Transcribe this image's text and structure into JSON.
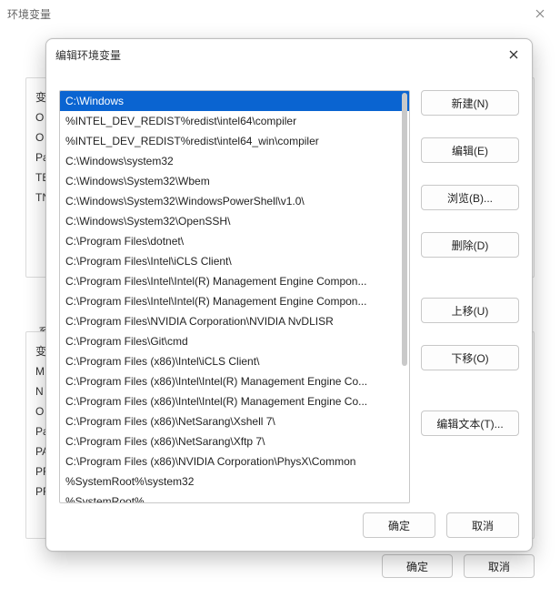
{
  "outer": {
    "title": "环境变量",
    "user_group_label": "",
    "sys_group_label": "系统",
    "user_col": [
      "变",
      "O",
      "O",
      "Pa",
      "TE",
      "TN"
    ],
    "sys_col": [
      "变",
      "M",
      "N",
      "O",
      "Pa",
      "PA",
      "PR",
      "PR"
    ],
    "ok_label": "确定",
    "cancel_label": "取消"
  },
  "dialog": {
    "title": "编辑环境变量",
    "buttons": {
      "new": "新建(N)",
      "edit": "编辑(E)",
      "browse": "浏览(B)...",
      "delete": "删除(D)",
      "move_up": "上移(U)",
      "move_down": "下移(O)",
      "edit_text": "编辑文本(T)...",
      "ok": "确定",
      "cancel": "取消"
    },
    "selected_index": 0,
    "items": [
      "C:\\Windows",
      "%INTEL_DEV_REDIST%redist\\intel64\\compiler",
      "%INTEL_DEV_REDIST%redist\\intel64_win\\compiler",
      "C:\\Windows\\system32",
      "C:\\Windows\\System32\\Wbem",
      "C:\\Windows\\System32\\WindowsPowerShell\\v1.0\\",
      "C:\\Windows\\System32\\OpenSSH\\",
      "C:\\Program Files\\dotnet\\",
      "C:\\Program Files\\Intel\\iCLS Client\\",
      "C:\\Program Files\\Intel\\Intel(R) Management Engine Compon...",
      "C:\\Program Files\\Intel\\Intel(R) Management Engine Compon...",
      "C:\\Program Files\\NVIDIA Corporation\\NVIDIA NvDLISR",
      "C:\\Program Files\\Git\\cmd",
      "C:\\Program Files (x86)\\Intel\\iCLS Client\\",
      "C:\\Program Files (x86)\\Intel\\Intel(R) Management Engine Co...",
      "C:\\Program Files (x86)\\Intel\\Intel(R) Management Engine Co...",
      "C:\\Program Files (x86)\\NetSarang\\Xshell 7\\",
      "C:\\Program Files (x86)\\NetSarang\\Xftp 7\\",
      "C:\\Program Files (x86)\\NVIDIA Corporation\\PhysX\\Common",
      "%SystemRoot%\\system32",
      "%SystemRoot%"
    ]
  }
}
